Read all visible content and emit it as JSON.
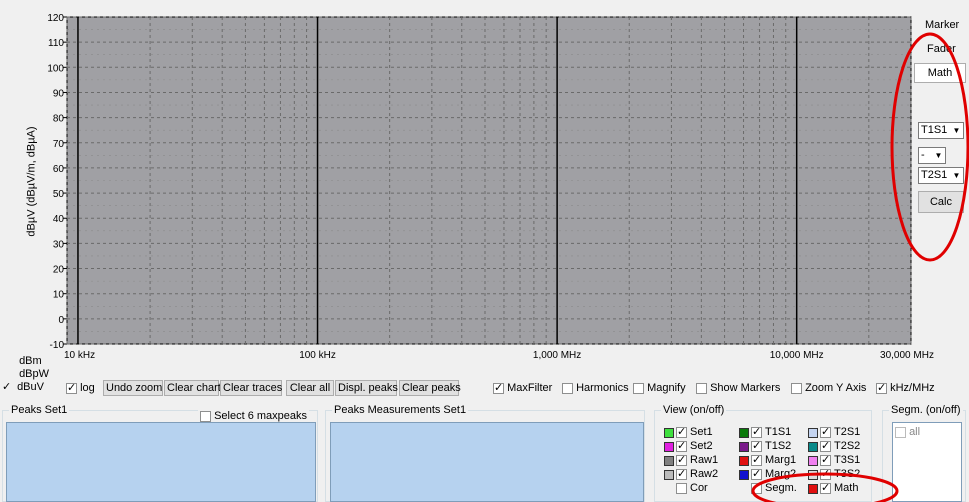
{
  "chart_data": {
    "type": "line",
    "ylabel": "dBµV (dBµV/m, dBµA)",
    "y_ticks": [
      "120",
      "110",
      "100",
      "90",
      "80",
      "70",
      "60",
      "50",
      "40",
      "30",
      "20",
      "10",
      "0",
      "-10"
    ],
    "ylim": [
      -10,
      120
    ],
    "x_scale": "log",
    "xlim_hz": [
      9000,
      30000000
    ],
    "x_tick_labels": [
      "10 kHz",
      "100 kHz",
      "1,000 MHz",
      "10,000 MHz",
      "30,000 MHz"
    ],
    "grid": true,
    "series": [],
    "plot_background": "#a0a0a4"
  },
  "unit_options": [
    {
      "label": "dBm",
      "checked": false
    },
    {
      "label": "dBpW",
      "checked": false
    },
    {
      "label": "dBuV",
      "checked": true
    }
  ],
  "toolbar": {
    "log": {
      "label": "log",
      "checked": true
    },
    "undo_zoom": "Undo zoom",
    "clear_chart": "Clear chart",
    "clear_traces": "Clear traces",
    "clear_all": "Clear all",
    "displ_peaks": "Displ. peaks",
    "clear_peaks": "Clear peaks",
    "maxfilter": {
      "label": "MaxFilter",
      "checked": true
    },
    "harmonics": {
      "label": "Harmonics",
      "checked": false
    },
    "magnify": {
      "label": "Magnify",
      "checked": false
    },
    "show_markers": {
      "label": "Show Markers",
      "checked": false
    },
    "zoom_y": {
      "label": "Zoom Y Axis",
      "checked": false
    },
    "khz_mhz": {
      "label": "kHz/MHz",
      "checked": true
    }
  },
  "right_panel": {
    "marker": "Marker",
    "fader": "Fader",
    "math": "Math",
    "sel1": "T1S1",
    "op": "-",
    "sel2": "T2S1",
    "calc": "Calc"
  },
  "peaks_set": {
    "title": "Peaks Set1",
    "select6": {
      "label": "Select 6 maxpeaks",
      "checked": false
    }
  },
  "peaks_meas": {
    "title": "Peaks Measurements Set1"
  },
  "view": {
    "title": "View (on/off)",
    "items": [
      {
        "label": "Set1",
        "color": "#3ee03e",
        "checked": true
      },
      {
        "label": "T1S1",
        "color": "#0a7a0a",
        "checked": true
      },
      {
        "label": "T2S1",
        "color": "#c4d4f0",
        "checked": true
      },
      {
        "label": "Set2",
        "color": "#e020e0",
        "checked": true
      },
      {
        "label": "T1S2",
        "color": "#7a1a8a",
        "checked": true
      },
      {
        "label": "T2S2",
        "color": "#0a8a8a",
        "checked": true
      },
      {
        "label": "Raw1",
        "color": "#808080",
        "checked": true
      },
      {
        "label": "Marg1",
        "color": "#e01010",
        "checked": true
      },
      {
        "label": "T3S1",
        "color": "#f080f0",
        "checked": true
      },
      {
        "label": "Raw2",
        "color": "#bbbbbb",
        "checked": true
      },
      {
        "label": "Marg2",
        "color": "#1010d0",
        "checked": true
      },
      {
        "label": "T3S2",
        "color": "#dddddd",
        "checked": true
      },
      {
        "label": "Cor",
        "color": null,
        "checked": false
      },
      {
        "label": "Segm.",
        "color": null,
        "checked": false
      },
      {
        "label": "Math",
        "color": "#e01010",
        "checked": true
      }
    ]
  },
  "segm": {
    "title": "Segm. (on/off)",
    "all": {
      "label": "all",
      "checked": false
    }
  },
  "annotation_color": "#e00000"
}
